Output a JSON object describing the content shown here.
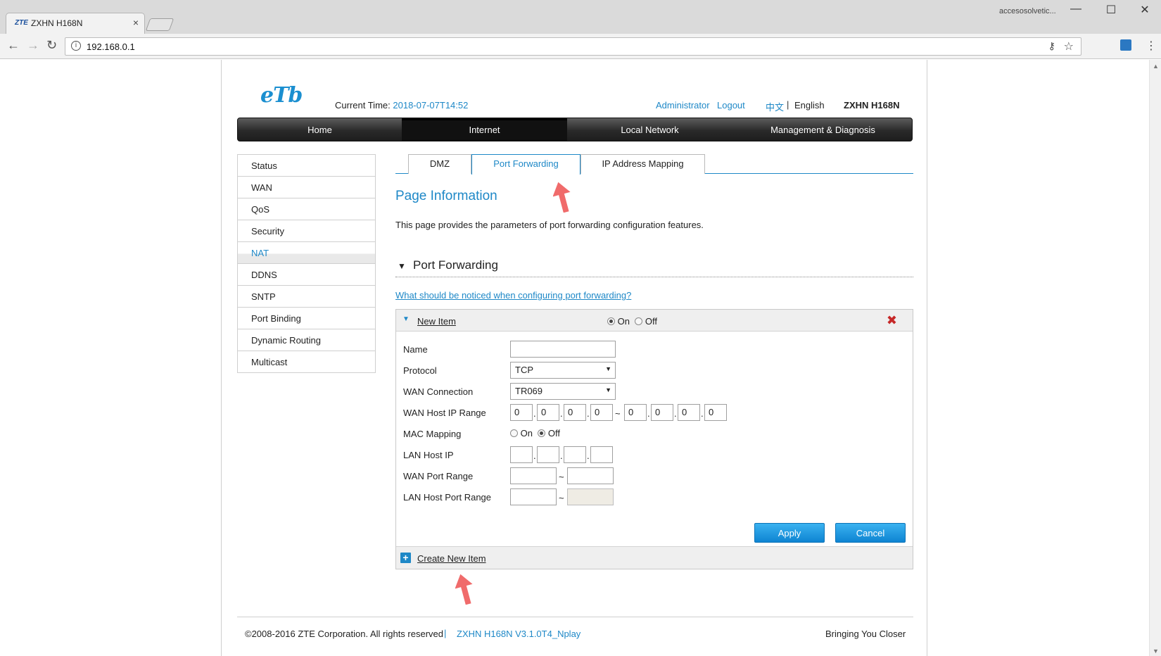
{
  "browser": {
    "tab_title": "ZXHN H168N",
    "tab_favicon": "ZTE",
    "url": "192.168.0.1",
    "user_label": "accesosolvetic...",
    "minimize": "—",
    "maximize": "☐",
    "close": "✕"
  },
  "header": {
    "logo_text": "eTb",
    "current_time_label": "Current Time:",
    "current_time_value": "2018-07-07T14:52",
    "admin_link": "Administrator",
    "logout_link": "Logout",
    "lang_cn": "中文",
    "lang_sep": "|",
    "lang_en": "English",
    "model": "ZXHN H168N"
  },
  "main_nav": {
    "items": [
      "Home",
      "Internet",
      "Local Network",
      "Management & Diagnosis"
    ],
    "active": "Internet"
  },
  "side_menu": {
    "items": [
      "Status",
      "WAN",
      "QoS",
      "Security",
      "NAT",
      "DDNS",
      "SNTP",
      "Port Binding",
      "Dynamic Routing",
      "Multicast"
    ],
    "active": "NAT"
  },
  "content_tabs": {
    "items": [
      "DMZ",
      "Port Forwarding",
      "IP Address Mapping"
    ],
    "active": "Port Forwarding"
  },
  "page": {
    "title": "Page Information",
    "description": "This page provides the parameters of port forwarding configuration features.",
    "section_title": "Port Forwarding",
    "help_link": "What should be noticed when configuring port forwarding?"
  },
  "new_item": {
    "name": "New Item",
    "on_label": "On",
    "off_label": "Off",
    "enabled": "On",
    "fields": {
      "name_label": "Name",
      "name_value": "",
      "protocol_label": "Protocol",
      "protocol_value": "TCP",
      "wan_connection_label": "WAN Connection",
      "wan_connection_value": "TR069",
      "wan_host_ip_range_label": "WAN Host IP Range",
      "wan_host_ip_start": [
        "0",
        "0",
        "0",
        "0"
      ],
      "wan_host_ip_end": [
        "0",
        "0",
        "0",
        "0"
      ],
      "range_sep": "~",
      "mac_mapping_label": "MAC Mapping",
      "mac_on": "On",
      "mac_off": "Off",
      "mac_mapping_value": "Off",
      "lan_host_ip_label": "LAN Host IP",
      "lan_host_ip": [
        "",
        "",
        "",
        ""
      ],
      "wan_port_range_label": "WAN Port Range",
      "wan_port_start": "",
      "wan_port_end": "",
      "lan_host_port_range_label": "LAN Host Port Range",
      "lan_port_start": "",
      "lan_port_end": ""
    },
    "apply_button": "Apply",
    "cancel_button": "Cancel",
    "create_new": "Create New Item"
  },
  "footer": {
    "copyright": "©2008-2016 ZTE Corporation. All rights reserved",
    "sep": "|",
    "version": "ZXHN H168N V3.1.0T4_Nplay",
    "tagline": "Bringing You Closer"
  },
  "colors": {
    "accent": "#1e88c7",
    "button": "#0e84d2",
    "annotation_arrow": "#f06b6b",
    "nav_bg": "#2a2a2a"
  },
  "icons": {
    "back": "arrow-left-icon",
    "forward": "arrow-right-icon",
    "reload": "reload-icon",
    "info": "info-icon",
    "key": "key-icon",
    "bookmark": "star-icon",
    "delete": "close-icon",
    "add": "plus-icon"
  }
}
